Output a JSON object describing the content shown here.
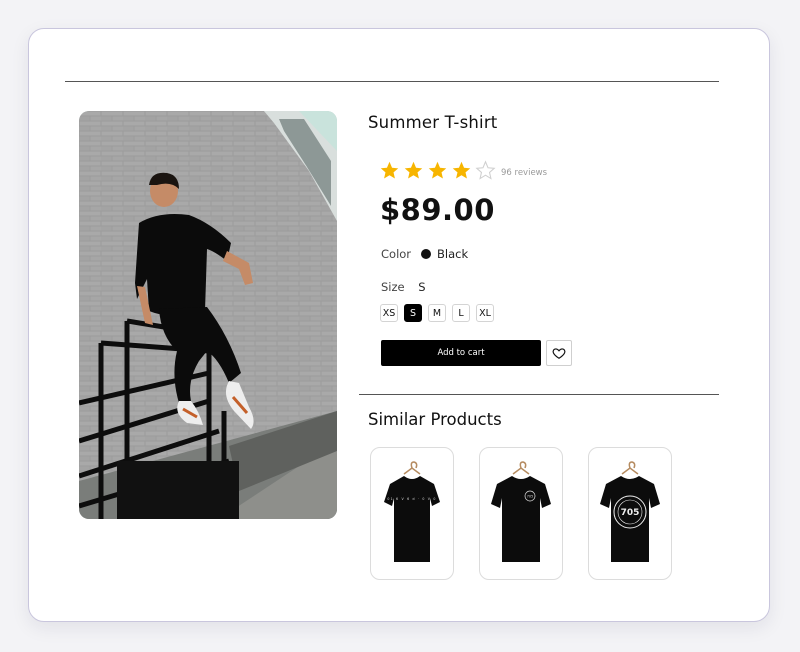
{
  "product": {
    "title": "Summer T-shirt",
    "rating": 4,
    "rating_max": 5,
    "reviews": "96 reviews",
    "price": "$89.00",
    "color_label": "Color",
    "color_value": "Black",
    "color_hex": "#111111",
    "size_label": "Size",
    "size_value": "S",
    "sizes": [
      "XS",
      "S",
      "M",
      "L",
      "XL"
    ],
    "add_to_cart": "Add to cart"
  },
  "similar": {
    "title": "Similar Products",
    "items": [
      {
        "icon": "tshirt-icon",
        "print_text": "01 6 V 6 d · 0 V 0"
      },
      {
        "icon": "tshirt-icon",
        "print_text": "705"
      },
      {
        "icon": "tshirt-icon",
        "print_text": "705"
      }
    ]
  },
  "colors": {
    "star": "#f7b500",
    "star_empty": "#cfcfcf",
    "accent": "#000000",
    "card_border": "#c9c6dd"
  }
}
